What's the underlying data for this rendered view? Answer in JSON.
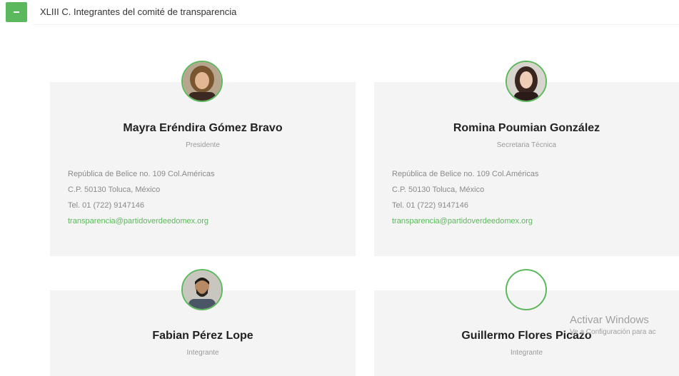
{
  "section": {
    "title": "XLIII C. Integrantes del comité de transparencia",
    "toggle_icon": "minus-icon",
    "accent_color": "#5cb85c"
  },
  "members": [
    {
      "name": "Mayra Eréndira Gómez Bravo",
      "role": "Presidente",
      "address1": "República de Belice no. 109 Col.Américas",
      "address2": "C.P. 50130 Toluca, México",
      "phone": "Tel. 01 (722) 9147146",
      "email": "transparencia@partidoverdeedomex.org"
    },
    {
      "name": "Romina Poumian González",
      "role": "Secretaria Técnica",
      "address1": "República de Belice no. 109 Col.Américas",
      "address2": "C.P. 50130 Toluca, México",
      "phone": "Tel. 01 (722) 9147146",
      "email": "transparencia@partidoverdeedomex.org"
    },
    {
      "name": "Fabian Pérez Lope",
      "role": "Integrante"
    },
    {
      "name": "Guillermo Flores Picazo",
      "role": "Integrante"
    }
  ],
  "watermark": {
    "title": "Activar Windows",
    "subtitle": "Ve a Configuración para ac"
  }
}
